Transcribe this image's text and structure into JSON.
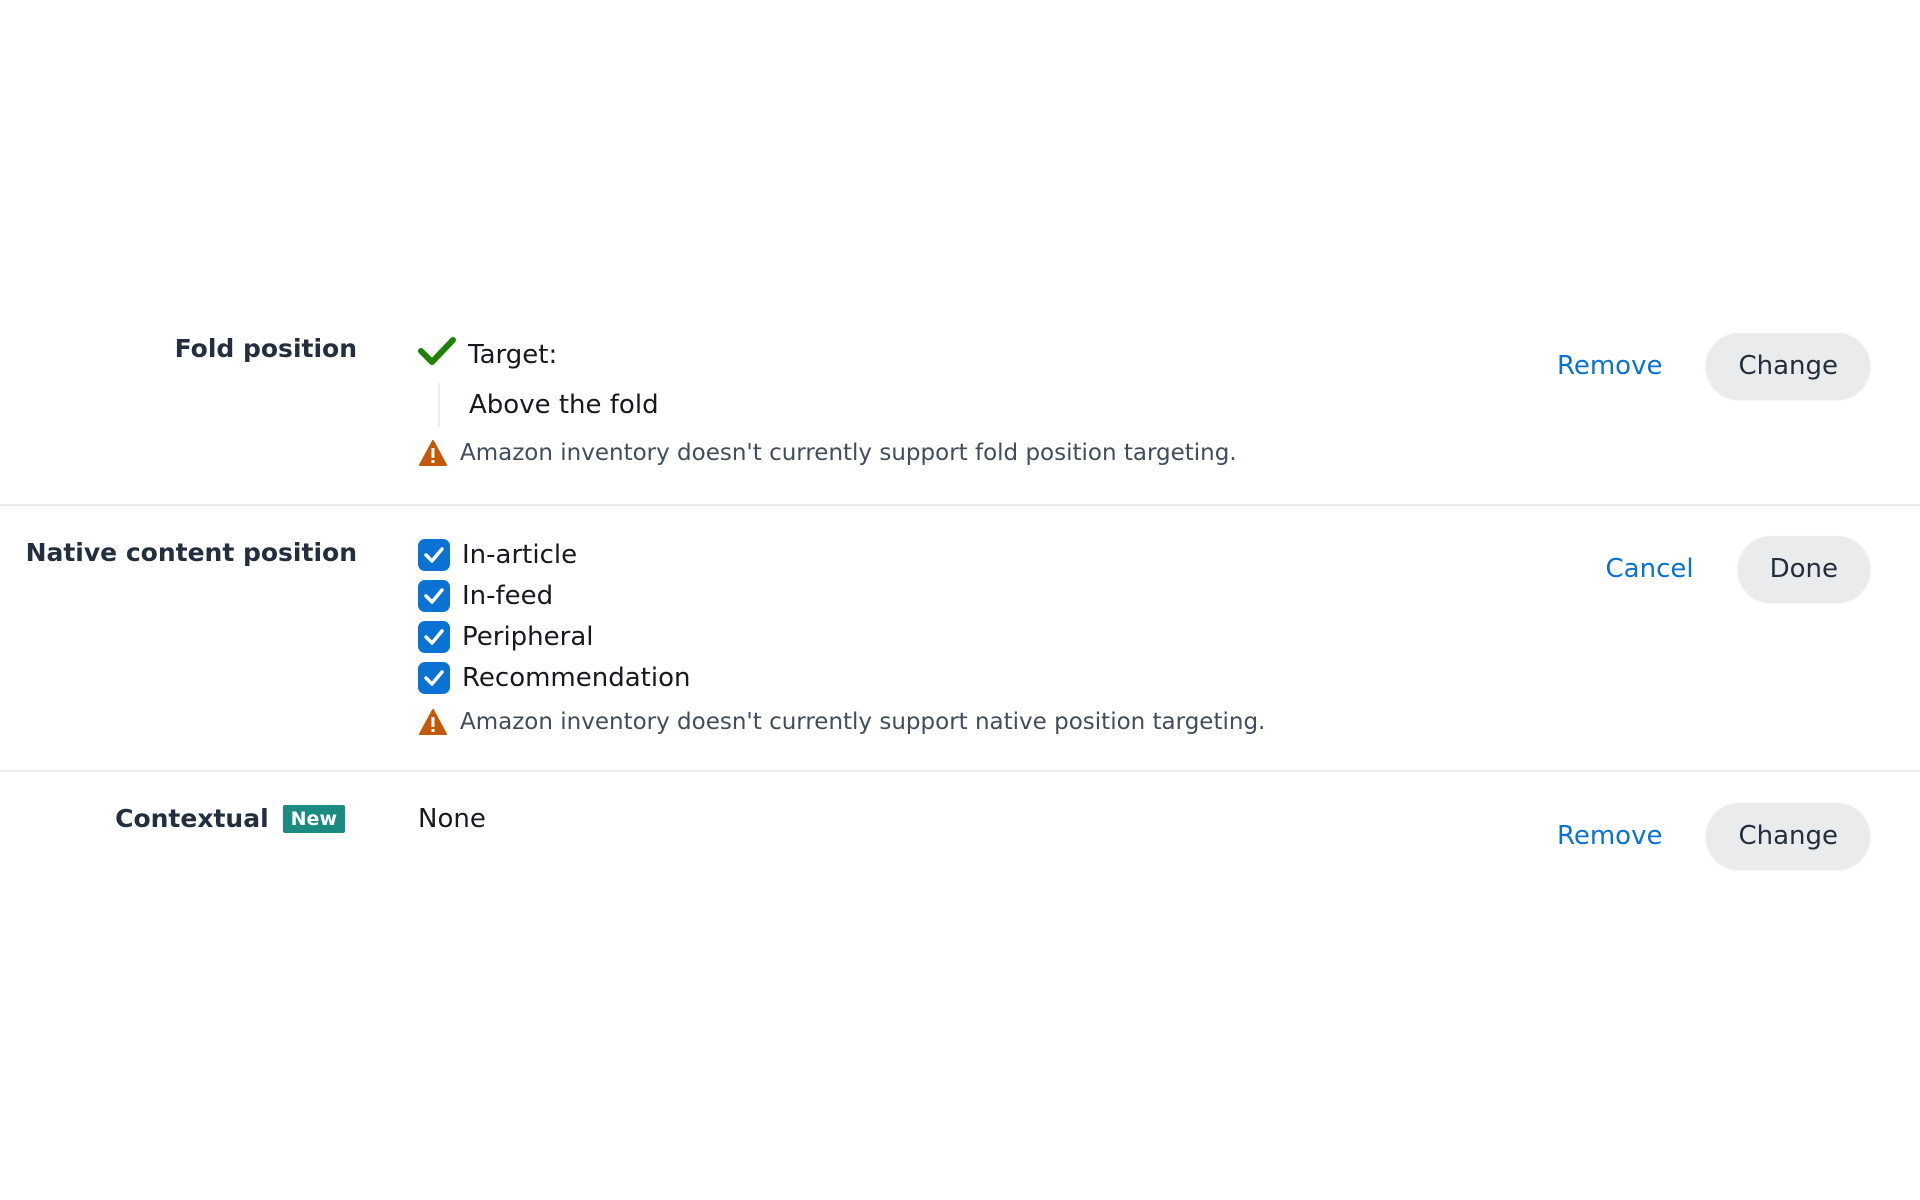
{
  "fold_position": {
    "label": "Fold position",
    "status_icon": "check-icon",
    "target_label": "Target:",
    "target_value": "Above the fold",
    "warning_icon": "warning-triangle-icon",
    "warning": "Amazon inventory doesn't currently support fold position targeting.",
    "remove_label": "Remove",
    "change_label": "Change"
  },
  "native_content_position": {
    "label": "Native content position",
    "options": [
      {
        "label": "In-article",
        "checked": true
      },
      {
        "label": "In-feed",
        "checked": true
      },
      {
        "label": "Peripheral",
        "checked": true
      },
      {
        "label": "Recommendation",
        "checked": true
      }
    ],
    "warning_icon": "warning-triangle-icon",
    "warning": "Amazon inventory doesn't currently support native position targeting.",
    "cancel_label": "Cancel",
    "done_label": "Done"
  },
  "contextual": {
    "label": "Contextual",
    "badge": "New",
    "value": "None",
    "remove_label": "Remove",
    "change_label": "Change"
  },
  "colors": {
    "link": "#0972d3",
    "checkbox": "#0972d3",
    "check_green": "#1d8102",
    "warning": "#c45a07",
    "badge": "#1b8a80",
    "button_bg": "#e9ebed"
  }
}
